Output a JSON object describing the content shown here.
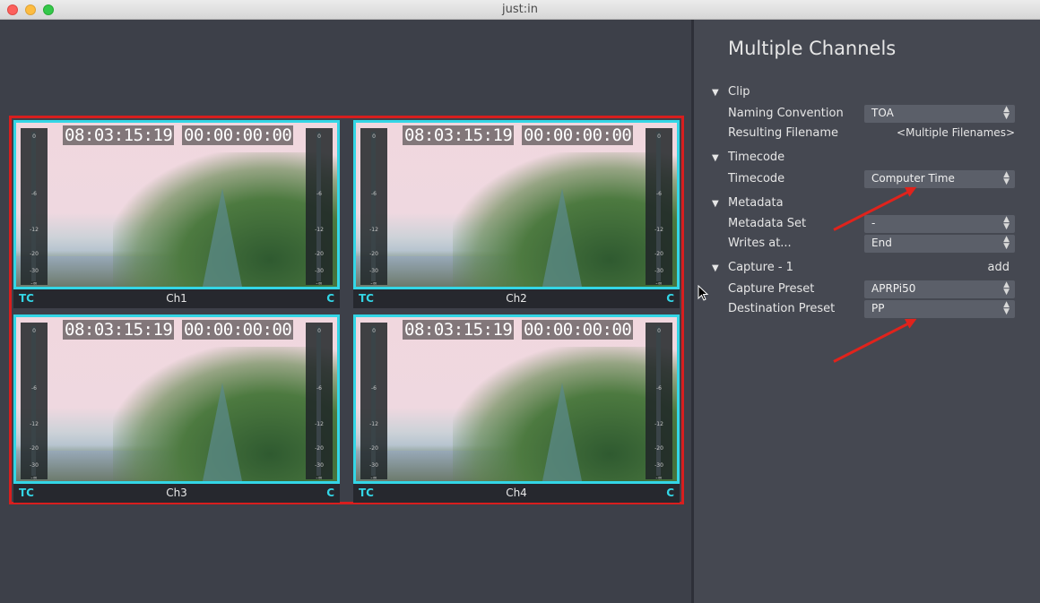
{
  "window": {
    "title": "just:in"
  },
  "channels": [
    {
      "label": "Ch1",
      "tc_flag": "TC",
      "c_flag": "C",
      "timecode": "08:03:15:19",
      "duration": "00:00:00:00"
    },
    {
      "label": "Ch2",
      "tc_flag": "TC",
      "c_flag": "C",
      "timecode": "08:03:15:19",
      "duration": "00:00:00:00"
    },
    {
      "label": "Ch3",
      "tc_flag": "TC",
      "c_flag": "C",
      "timecode": "08:03:15:19",
      "duration": "00:00:00:00"
    },
    {
      "label": "Ch4",
      "tc_flag": "TC",
      "c_flag": "C",
      "timecode": "08:03:15:19",
      "duration": "00:00:00:00"
    }
  ],
  "meter_ticks": [
    "0",
    "-6",
    "-12",
    "-20",
    "-30",
    "-∞"
  ],
  "panel": {
    "title": "Multiple Channels",
    "clip": {
      "header": "Clip",
      "naming_label": "Naming Convention",
      "naming_value": "TOA",
      "filename_label": "Resulting Filename",
      "filename_value": "<Multiple Filenames>"
    },
    "timecode": {
      "header": "Timecode",
      "label": "Timecode",
      "value": "Computer Time"
    },
    "metadata": {
      "header": "Metadata",
      "set_label": "Metadata Set",
      "set_value": "-",
      "writes_label": "Writes at...",
      "writes_value": "End"
    },
    "capture": {
      "header": "Capture - 1",
      "add_label": "add",
      "preset_label": "Capture Preset",
      "preset_value": "APRPi50",
      "dest_label": "Destination Preset",
      "dest_value": "PP"
    }
  },
  "colors": {
    "accent": "#33d6e6",
    "highlight": "#d81e1e",
    "annotation": "#e0231c"
  },
  "icons": {
    "disclosure": "triangle-down-icon",
    "popup": "updown-chevron-icon"
  }
}
